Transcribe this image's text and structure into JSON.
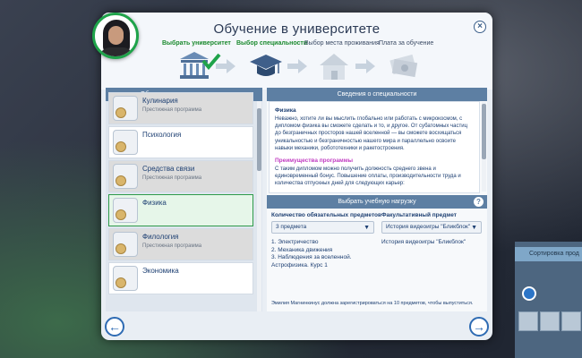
{
  "background": {
    "side_strip": "Сортировка прод"
  },
  "dialog": {
    "title": "Обучение в университете",
    "close_glyph": "×"
  },
  "steps": [
    {
      "label": "Выбрать университет",
      "state": "done"
    },
    {
      "label": "Выбор специальности",
      "state": "current"
    },
    {
      "label": "Выбор места проживания",
      "state": "todo"
    },
    {
      "label": "Плата за обучение",
      "state": "todo"
    }
  ],
  "left_panel": {
    "header": "Образовательные программы",
    "programs": [
      {
        "name": "Кулинария",
        "sub": "Престижная программа",
        "prestige": true,
        "selected": false
      },
      {
        "name": "Психология",
        "sub": "",
        "prestige": false,
        "selected": false
      },
      {
        "name": "Средства связи",
        "sub": "Престижная программа",
        "prestige": true,
        "selected": false
      },
      {
        "name": "Физика",
        "sub": "",
        "prestige": false,
        "selected": true
      },
      {
        "name": "Филология",
        "sub": "Престижная программа",
        "prestige": true,
        "selected": false
      },
      {
        "name": "Экономика",
        "sub": "",
        "prestige": false,
        "selected": false
      }
    ]
  },
  "right_panel": {
    "header": "Сведения о специальности",
    "info": {
      "heading": "Физика",
      "description": "Неважно, хотите ли вы мыслить глобально или работать с микрокосмом, с дипломом физика вы сможете сделать и то, и другое. От субатомных частиц до безграничных просторов нашей вселенной — вы сможете восхищаться уникальностью и безграничностью нашего мира и параллельно освоите навыки механики, робототехники и ракетостроения.",
      "advantages_heading": "Преимущества программы",
      "advantages_text": "С таким дипломом можно получить должность среднего звена и единовременный бонус. Повышение оплаты, производительности труда и количества отпускных дней для следующих карьер:"
    },
    "load": {
      "header": "Выбрать учебную нагрузку",
      "required_label": "Количество обязательных предметов",
      "required_value": "3 предмета",
      "elective_label": "Факультативный предмет",
      "elective_value": "История видеоигры \"Бликблок\"",
      "courses": [
        "1. Электричество",
        "2. Механика движения",
        "3. Наблюдения за вселенной. Астрофизика. Курс 1"
      ],
      "elective_course": "История видеоигры \"Бликблок\"",
      "notice": "Эмилия Магнинкинус должна зарегистрироваться на 10 предметов, чтобы выпуститься."
    }
  },
  "nav": {
    "back": "←",
    "next": "→"
  },
  "colors": {
    "accent": "#2e9a4a",
    "header_bar": "#5d7fa3",
    "title": "#2b3a55"
  },
  "icons": [
    "university-icon",
    "checkmark-icon",
    "graduation-cap-icon",
    "house-icon",
    "money-icon"
  ]
}
